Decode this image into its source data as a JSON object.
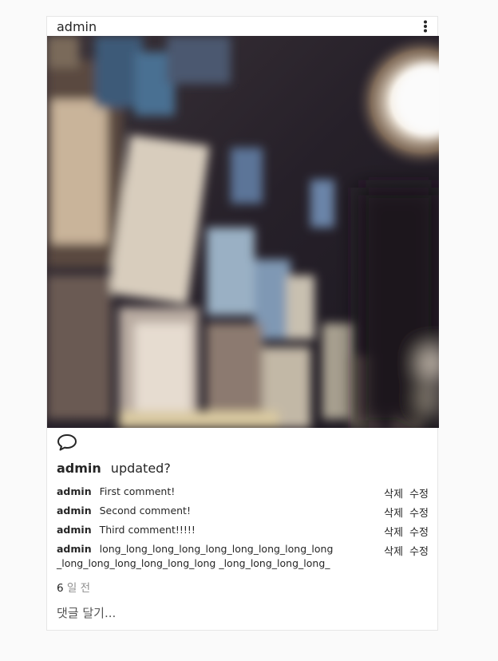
{
  "post": {
    "author": "admin",
    "caption_user": "admin",
    "caption_text": "updated?",
    "time_number": "6",
    "time_unit": "일 전",
    "add_comment_placeholder": "댓글 달기..."
  },
  "comments": [
    {
      "user": "admin",
      "text": "First comment!",
      "delete": "삭제",
      "edit": "수정"
    },
    {
      "user": "admin",
      "text": "Second comment!",
      "delete": "삭제",
      "edit": "수정"
    },
    {
      "user": "admin",
      "text": "Third comment!!!!!",
      "delete": "삭제",
      "edit": "수정"
    },
    {
      "user": "admin",
      "text": "long_long_long_long_long_long_long_long_long_long_long_long_long_long_long _long_long_long_long_",
      "delete": "삭제",
      "edit": "수정"
    }
  ],
  "icons": {
    "more": "vertical-ellipsis-icon",
    "comment": "speech-bubble-icon"
  }
}
